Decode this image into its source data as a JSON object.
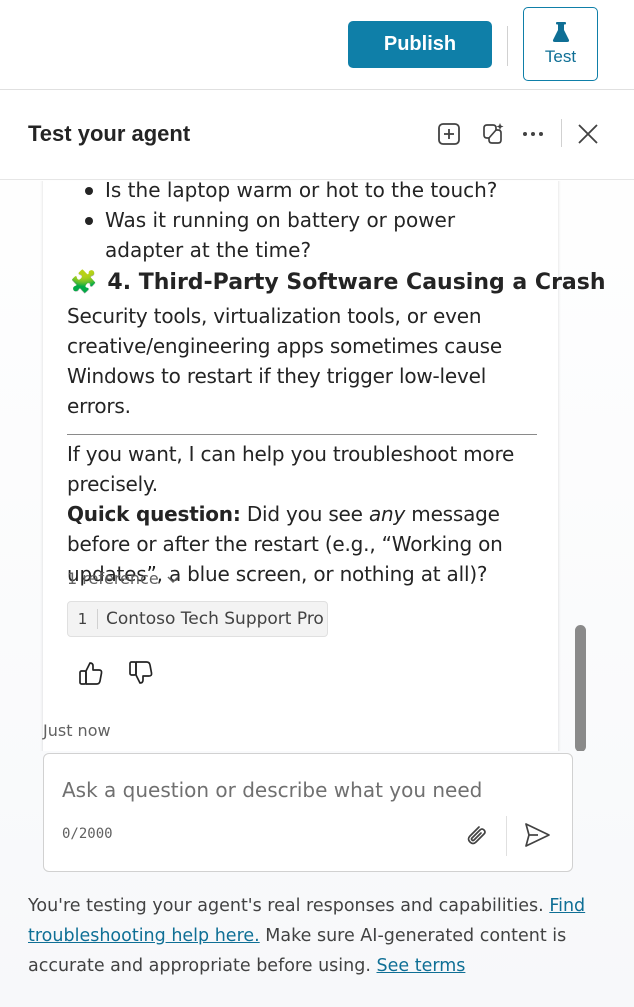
{
  "topbar": {
    "publish_label": "Publish",
    "test_label": "Test",
    "test_icon": "flask-icon"
  },
  "panel": {
    "title": "Test your agent",
    "icons": [
      "new-chat-icon",
      "copilot-icon",
      "more-icon",
      "close-icon"
    ]
  },
  "message": {
    "bullets": [
      "Is the laptop warm or hot to the touch?",
      "Was it running on battery or power adapter at the time?"
    ],
    "heading_emoji": "🧩",
    "heading": "4. Third-Party Software Causing a Crash",
    "heading_paragraph": "Security tools, virtualization tools, or even creative/engineering apps sometimes cause Windows to restart if they trigger low-level errors.",
    "offer": "If you want, I can help you troubleshoot more precisely.",
    "question_label": "Quick question:",
    "question_part1": "Did you see",
    "question_emphasis": "any",
    "question_part2": "message before or after the restart (e.g., “Working on updates”, a blue screen, or nothing at all)?",
    "reference_toggle": "1 reference",
    "references": [
      {
        "num": "1",
        "name": "Contoso Tech Support Pro"
      }
    ],
    "timestamp": "Just now"
  },
  "input": {
    "placeholder": "Ask a question or describe what you need",
    "value": "",
    "char_count": "0/2000"
  },
  "disclaimer": {
    "text1": "You're testing your agent's real responses and capabilities.",
    "link1": "Find troubleshooting help here.",
    "text2": "Make sure AI-generated content is accurate and appropriate before using.",
    "link2": "See terms"
  },
  "colors": {
    "accent": "#0f7fa8",
    "link": "#0f6f95"
  }
}
